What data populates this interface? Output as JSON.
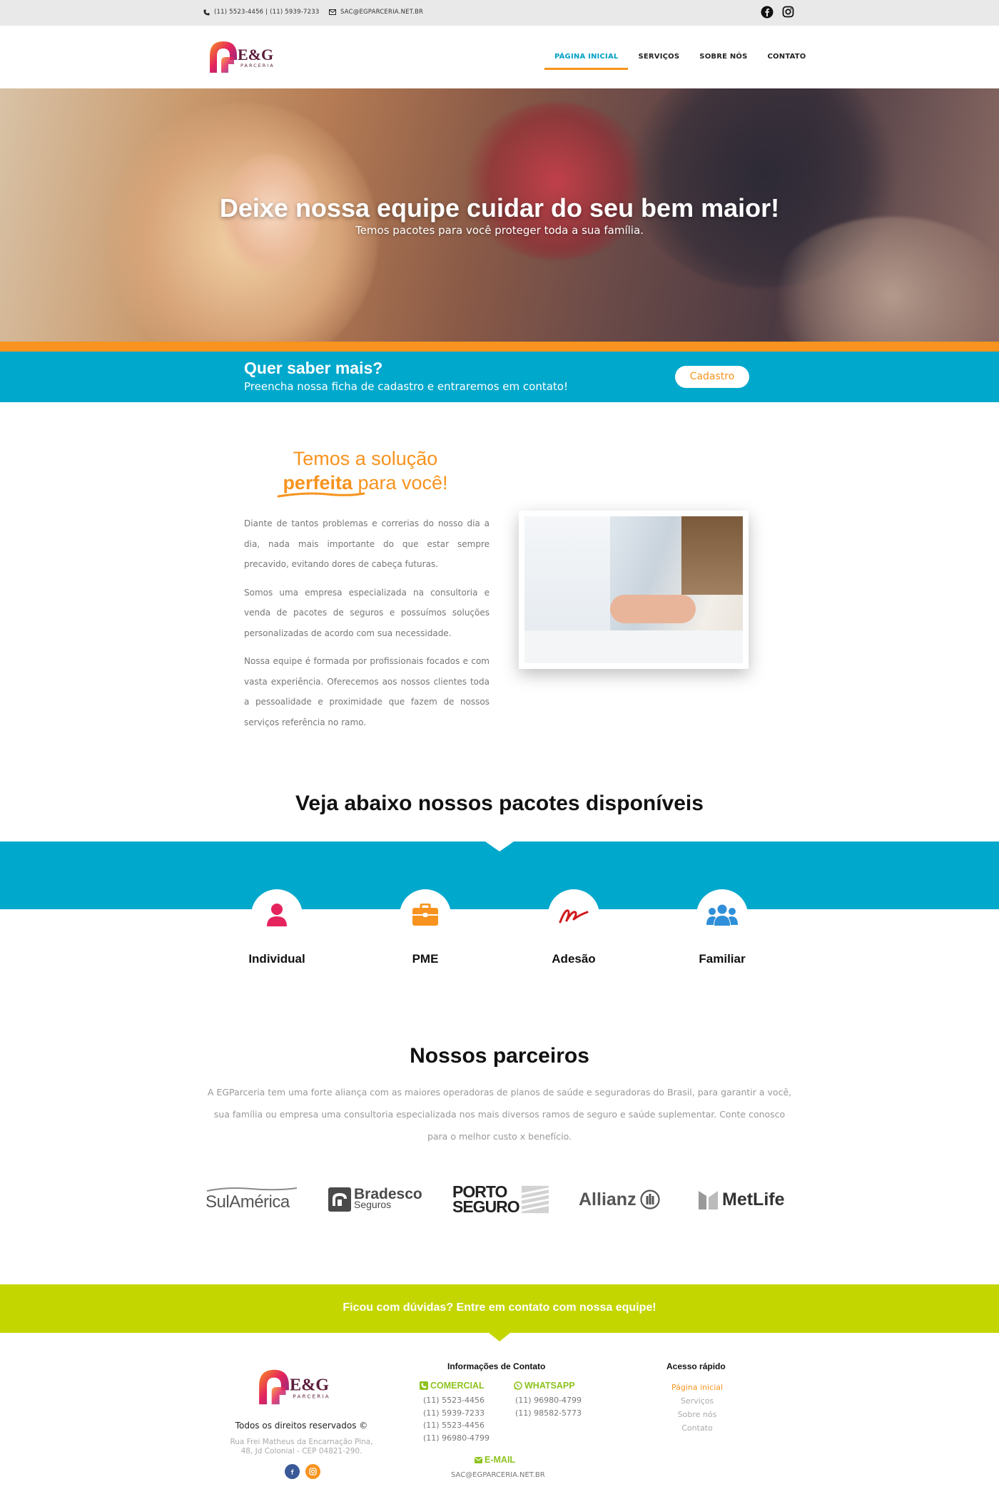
{
  "topbar": {
    "phone": "(11) 5523-4456 | (11) 5939-7233",
    "email": "SAC@EGPARCERIA.NET.BR",
    "social": [
      "facebook-icon",
      "instagram-icon"
    ]
  },
  "logo": {
    "brand": "E&G",
    "sub": "PARCERIA"
  },
  "nav": {
    "items": [
      {
        "label": "PÁGINA INICIAL",
        "active": true
      },
      {
        "label": "SERVIÇOS"
      },
      {
        "label": "SOBRE NÓS"
      },
      {
        "label": "CONTATO"
      }
    ]
  },
  "hero": {
    "title": "Deixe nossa equipe cuidar do seu bem maior!",
    "subtitle": "Temos pacotes para você proteger toda a sua família."
  },
  "cta": {
    "title": "Quer saber mais?",
    "text": "Preencha nossa ficha de cadastro e entraremos em contato!",
    "button": "Cadastro"
  },
  "about": {
    "title_line1": "Temos a solução",
    "title_highlight": "perfeita",
    "title_rest": " para você!",
    "paragraphs": [
      "Diante de tantos problemas e correrias do nosso dia a dia, nada mais importante do que estar sempre precavido, evitando dores de cabeça futuras.",
      "Somos uma empresa especializada na consultoria e venda de pacotes de seguros e possuímos soluções personalizadas de acordo com sua necessidade.",
      "Nossa equipe é formada por profissionais focados e com vasta experiência. Oferecemos aos nossos clientes toda a pessoalidade e proximidade que fazem de nossos serviços referência no ramo."
    ]
  },
  "packages": {
    "title": "Veja abaixo nossos pacotes disponíveis",
    "items": [
      {
        "label": "Individual",
        "icon": "user-icon",
        "color": "#e5245e"
      },
      {
        "label": "PME",
        "icon": "briefcase-icon",
        "color": "#f7931e"
      },
      {
        "label": "Adesão",
        "icon": "signature-icon",
        "color": "#d0191c"
      },
      {
        "label": "Familiar",
        "icon": "users-icon",
        "color": "#2f8fd8"
      }
    ]
  },
  "partners": {
    "title": "Nossos parceiros",
    "text": "A EGParceria tem uma forte aliança com as maiores operadoras de planos de saúde e seguradoras do Brasil, para garantir a você, sua família ou empresa uma consultoria especializada nos mais diversos ramos de seguro e saúde suplementar. Conte conosco para o melhor custo x benefício.",
    "logos": [
      "SulAmérica",
      "Bradesco",
      "Seguros",
      "PORTO",
      "SEGURO",
      "Allianz",
      "MetLife"
    ]
  },
  "footer_cta": {
    "text": "Ficou com dúvidas? Entre em contato com nossa equipe!"
  },
  "footer": {
    "rights": "Todos os direitos reservados ©",
    "address_line1": "Rua Frei Matheus da Encarnação Pina,",
    "address_line2": "48, Jd Colonial - CEP 04821-290.",
    "contact_title": "Informações de Contato",
    "comercial_title": "COMERCIAL",
    "comercial": [
      "(11) 5523-4456",
      "(11) 5939-7233",
      "(11) 5523-4456",
      "(11) 96980-4799"
    ],
    "whatsapp_title": "WHATSAPP",
    "whatsapp": [
      "(11) 96980-4799",
      "(11) 98582-5773"
    ],
    "email_title": "E-MAIL",
    "email": "SAC@EGPARCERIA.NET.BR",
    "links_title": "Acesso rápido",
    "links": [
      "Página inicial",
      "Serviços",
      "Sobre nós",
      "Contato"
    ]
  },
  "colors": {
    "primary": "#00a8cc",
    "accent": "#f7931e",
    "lime": "#c4d600",
    "green": "#8dc21f"
  }
}
